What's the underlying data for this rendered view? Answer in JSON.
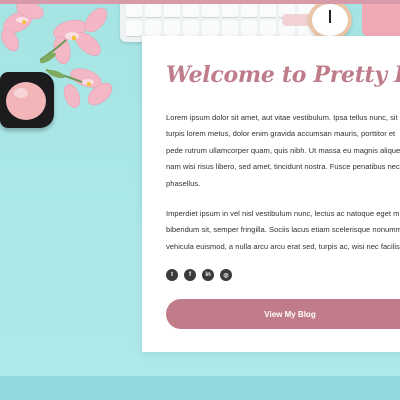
{
  "hero": {
    "title": "Welcome to Pretty Pinky",
    "paragraphs": [
      [
        "Lorem ipsum dolor sit amet, aut vitae vestibulum. Ipsa tellus nunc, sit",
        "turpis lorem metus, dolor enim gravida accumsan mauris, porttitor et",
        "pede rutrum ullamcorper quam, quis nibh. Ut massa eu magnis aliquet,",
        "nam wisi risus libero, sed amet, tincidunt nostra. Fusce penatibus nec",
        "phasellus."
      ],
      [
        "Imperdiet ipsum in vel nisl vestibulum nunc, lectus ac natoque eget m",
        "bibendum sit, semper fringilla. Sociis lacus etiam scelerisque nonumm",
        "vehicula euismod, a nulla arcu arcu erat sed, turpis ac, wisi nec facilis"
      ]
    ],
    "social": [
      {
        "name": "twitter-icon",
        "glyph": "t"
      },
      {
        "name": "facebook-icon",
        "glyph": "f"
      },
      {
        "name": "linkedin-icon",
        "glyph": "in"
      },
      {
        "name": "instagram-icon",
        "glyph": "◎"
      }
    ],
    "cta_label": "View My Blog"
  },
  "colors": {
    "accent": "#c07c88",
    "title": "#bf7d8b",
    "background": "#a9e6e6"
  }
}
